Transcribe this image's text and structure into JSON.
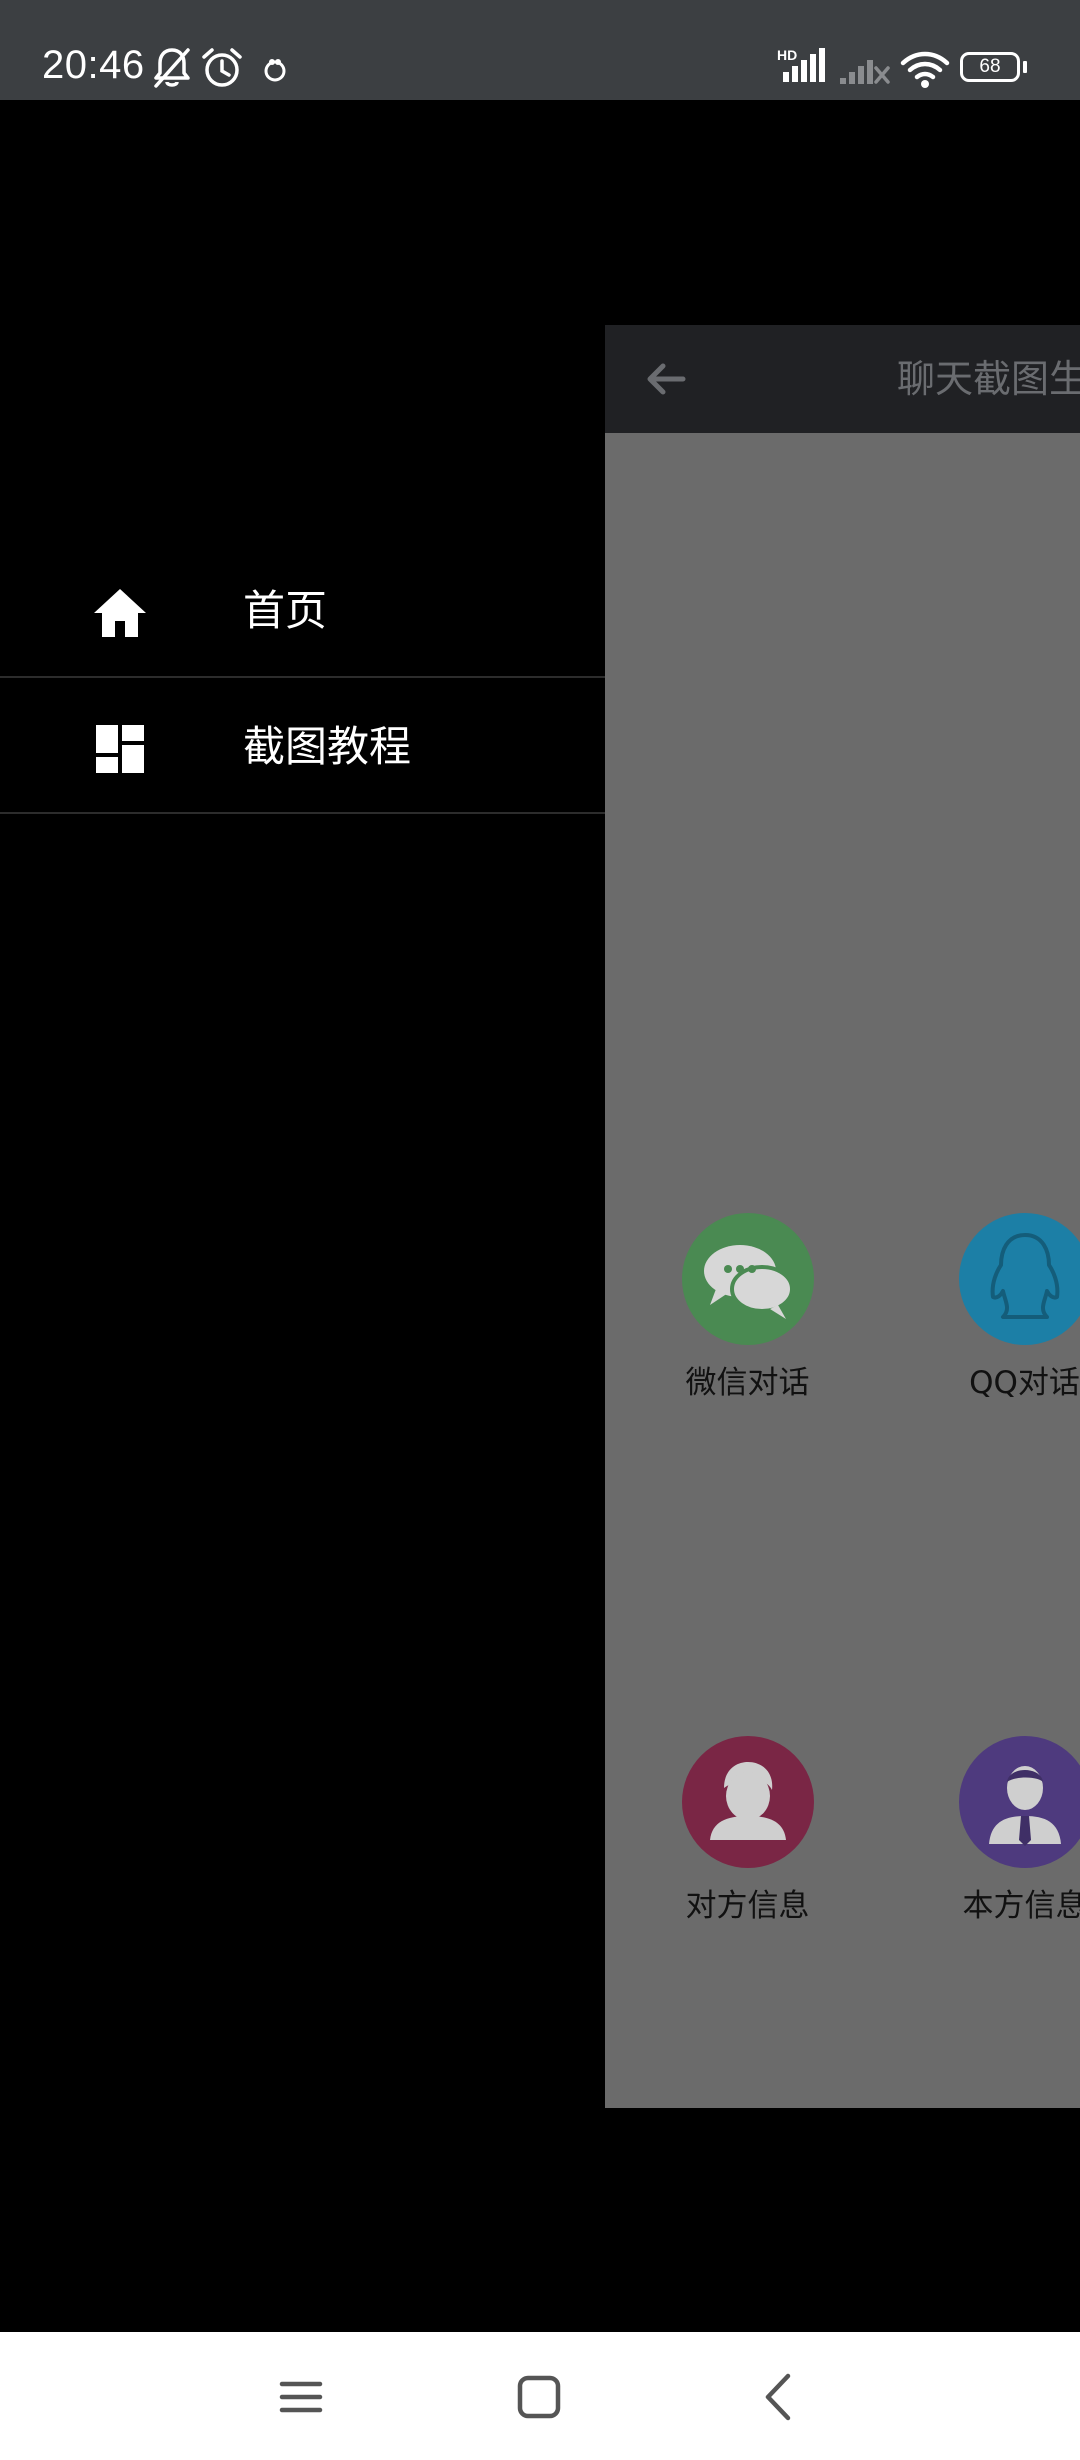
{
  "status_bar": {
    "time": "20:46",
    "icons": [
      "bell-off-icon",
      "alarm-icon",
      "app-notification-icon",
      "hd-signal-icon",
      "signal-no-service-icon",
      "wifi-icon",
      "battery-icon"
    ],
    "battery_level": "68",
    "hd_label": "HD"
  },
  "drawer": {
    "items": [
      {
        "icon": "home-icon",
        "label": "首页"
      },
      {
        "icon": "dashboard-icon",
        "label": "截图教程"
      }
    ]
  },
  "preview": {
    "toolbar": {
      "back_icon": "arrow-back-icon",
      "title": "聊天截图生"
    },
    "tiles": [
      {
        "icon": "wechat-chat-icon",
        "label": "微信对话",
        "color": "#4a8a52"
      },
      {
        "icon": "qq-penguin-icon",
        "label": "QQ对话",
        "color": "#1c7fa6"
      },
      {
        "icon": "contact-person-icon",
        "label": "对方信息",
        "color": "#7a2645"
      },
      {
        "icon": "self-person-icon",
        "label": "本方信息",
        "color": "#4e3a7e"
      }
    ]
  },
  "nav_bar": {
    "buttons": [
      "menu-icon",
      "home-square-icon",
      "back-chevron-icon"
    ]
  },
  "colors": {
    "status_bar_bg": "#3c3f42",
    "drawer_bg": "#000000",
    "preview_toolbar_bg": "#202124",
    "preview_body_bg": "#6b6b6b",
    "nav_bar_bg": "#ffffff"
  }
}
